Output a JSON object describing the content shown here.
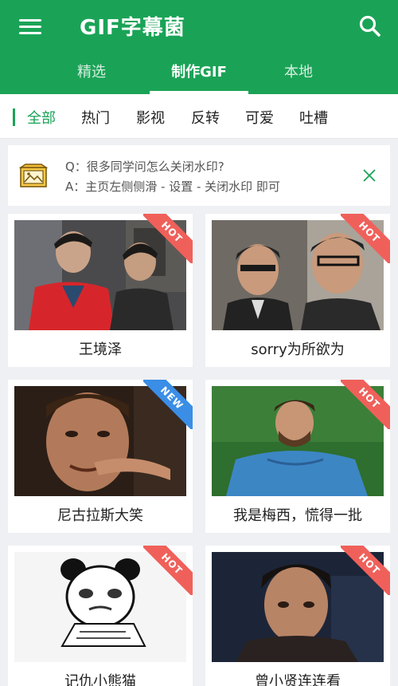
{
  "header": {
    "title": "GIF字幕菌",
    "tabs": [
      {
        "label": "精选",
        "active": false
      },
      {
        "label": "制作GIF",
        "active": true
      },
      {
        "label": "本地",
        "active": false
      }
    ]
  },
  "categories": [
    {
      "label": "全部",
      "active": true
    },
    {
      "label": "热门",
      "active": false
    },
    {
      "label": "影视",
      "active": false
    },
    {
      "label": "反转",
      "active": false
    },
    {
      "label": "可爱",
      "active": false
    },
    {
      "label": "吐槽",
      "active": false
    }
  ],
  "tip": {
    "question": "Q：很多同学问怎么关闭水印?",
    "answer": "A：主页左侧侧滑 - 设置 - 关闭水印 即可"
  },
  "cards": [
    {
      "label": "王境泽",
      "badge": "HOT"
    },
    {
      "label": "sorry为所欲为",
      "badge": "HOT"
    },
    {
      "label": "尼古拉斯大笑",
      "badge": "NEW"
    },
    {
      "label": "我是梅西，慌得一批",
      "badge": "HOT"
    },
    {
      "label": "记仇小熊猫",
      "badge": "HOT"
    },
    {
      "label": "曾小贤连连看",
      "badge": "HOT"
    }
  ],
  "colors": {
    "primary": "#1aa356",
    "hot": "#f0605a",
    "new": "#3a8ee6"
  }
}
